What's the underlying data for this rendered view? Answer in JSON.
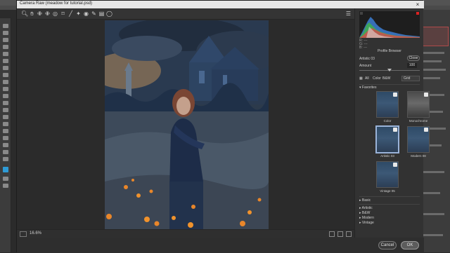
{
  "camera_raw": {
    "window_title": "Camera Raw (meadow for tutorial.psd)",
    "close_glyph": "×",
    "toolbar_icons": [
      "zoom-icon",
      "hand-icon",
      "white-balance-icon",
      "color-sampler-icon",
      "targeted-adjustment-icon",
      "crop-icon",
      "straighten-icon",
      "spot-removal-icon",
      "red-eye-icon",
      "adjustment-brush-icon",
      "graduated-filter-icon",
      "radial-filter-icon"
    ],
    "zoom_level": "16.6%",
    "cancel_label": "Cancel",
    "ok_label": "OK"
  },
  "panel": {
    "rgb": {
      "r": "R: ---",
      "g": "G: ---",
      "b": "B: ---"
    },
    "profile_browser_title": "Profile Browser",
    "profile_name": "Artistic 03",
    "close_button": "Close",
    "amount_label": "Amount",
    "amount_value": "100",
    "amount_fraction": 0.5,
    "filters": [
      "All",
      "Color",
      "B&W"
    ],
    "sort_value": "Grid",
    "favorites_label": "Favorites",
    "favorites": [
      {
        "label": "Color"
      },
      {
        "label": "Monochrome"
      },
      {
        "label": "Artistic 03"
      },
      {
        "label": "Modern 08"
      },
      {
        "label": "Vintage 05"
      }
    ],
    "sections": [
      "Basic",
      "Artistic",
      "B&W",
      "Modern",
      "Vintage"
    ]
  },
  "colors": {
    "accent": "#9ab3d9",
    "dialog_bg": "#2e2e2e",
    "panel_bg": "#323232"
  }
}
